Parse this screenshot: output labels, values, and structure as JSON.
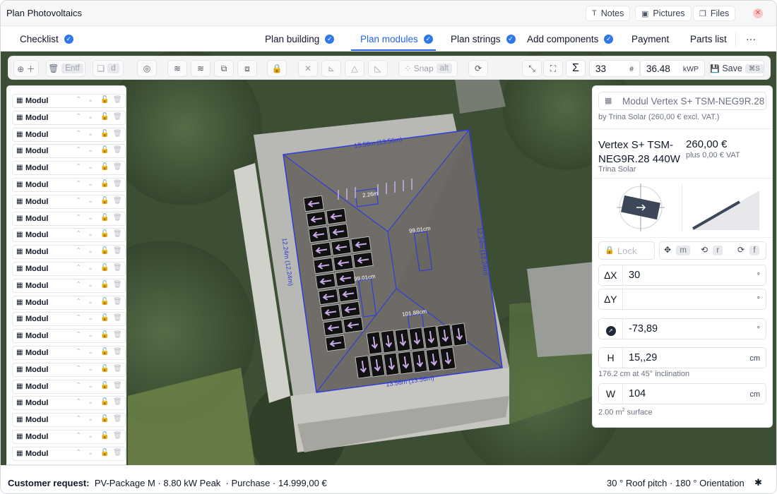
{
  "window": {
    "title": "Plan Photovoltaics"
  },
  "header_buttons": [
    {
      "label": "Notes",
      "icon": "text-icon"
    },
    {
      "label": "Pictures",
      "icon": "image-icon"
    },
    {
      "label": "Files",
      "icon": "files-icon"
    }
  ],
  "tabs": [
    {
      "label": "Checklist",
      "checked": true
    },
    {
      "label": "Plan building",
      "checked": true
    },
    {
      "label": "Plan modules",
      "checked": true,
      "active": true
    },
    {
      "label": "Plan strings",
      "checked": true
    },
    {
      "label": "Add components",
      "checked": true
    },
    {
      "label": "Payment",
      "checked": false
    },
    {
      "label": "Parts list",
      "checked": false
    }
  ],
  "toolbar": {
    "delete_key": "Entf",
    "duplicate_key": "d",
    "snap_label": "Snap",
    "snap_key": "alt",
    "module_count": "33",
    "module_count_unit": "#",
    "kwp_value": "36.48",
    "kwp_unit": "kWP",
    "save_label": "Save",
    "save_shortcut": "⌘S"
  },
  "module_list": {
    "item_label": "Modul",
    "count": 22
  },
  "roof_labels": {
    "top_edge": "13.56m (13.56m)",
    "bottom_edge": "13.56m (13.56m)",
    "left_edge": "12.24m (12.24m)",
    "right_edge": "12.24m (12.24m)",
    "inner_dim_1": "2.26m",
    "inner_dim_2": "99.01cm",
    "inner_dim_3": "99.01cm",
    "inner_dim_4": "99.01cm",
    "inner_dim_5": "101.88cm"
  },
  "module_panel": {
    "selected_model": "Modul Vertex S+ TSM-NEG9R.28",
    "manufacturer_line": "by Trina Solar (260,00 € excl. VAT.)",
    "product_name_line1": "Vertex S+ TSM-",
    "product_name_line2": "NEG9R.28 440W",
    "brand": "Trina Solar",
    "price": "260,00 €",
    "vat_line": "plus 0,00 € VAT",
    "lock_label": "Lock",
    "move_key": "m",
    "rotate_key": "r",
    "flip_key": "f",
    "delta_x_label": "∆X",
    "delta_x_value": "30",
    "delta_x_unit": "°",
    "delta_y_label": "∆Y",
    "delta_y_value": "",
    "delta_y_unit": "°",
    "azimuth_value": "-73,89",
    "azimuth_unit": "°",
    "height_label": "H",
    "height_value": "15,,29",
    "height_unit": "cm",
    "height_hint": "176.2 cm at 45° inclination",
    "width_label": "W",
    "width_value": "104",
    "width_unit": "cm",
    "surface_value": "2.00 m",
    "surface_sup": "2",
    "surface_word": " surface"
  },
  "status": {
    "customer_label": "Customer request:",
    "package": "PV-Package M",
    "peak": "8.80 kW Peak",
    "purchase": "Purchase",
    "price": "14.999,00 €",
    "roof_pitch": "30 ° Roof pitch",
    "orientation": "180 ° Orientation"
  },
  "colors": {
    "accent": "#2563eb",
    "roof_outline": "#2f3fd6",
    "panel": "#111111",
    "arrow": "#c9a9e6"
  }
}
